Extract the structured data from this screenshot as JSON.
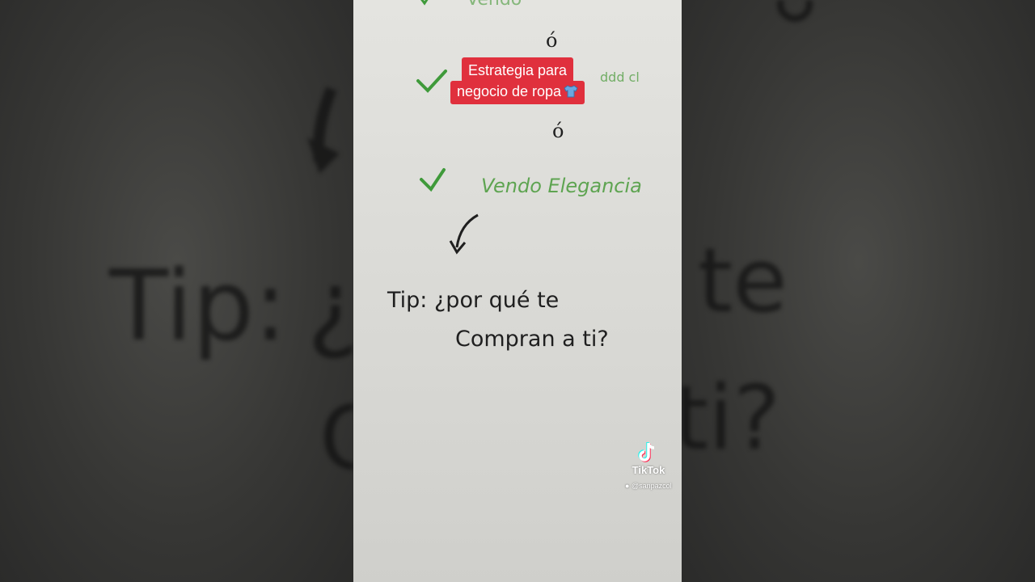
{
  "caption": {
    "line1": "Estrategia para",
    "line2": "negocio de ropa"
  },
  "watermark": {
    "brand": "TikTok",
    "handle": "@sanpazcol"
  },
  "board": {
    "or_1": "ó",
    "or_2": "ó",
    "item_3": "Vendo Elegancia",
    "tip_line1": "Tip: ¿por qué te",
    "tip_line2": "Compran a ti?"
  },
  "colors": {
    "caption_bg": "#e0303d",
    "check_green": "#3f9a3a",
    "marker_black": "#1f1f1f"
  },
  "icons": [
    "shirt-emoji-icon",
    "check-icon",
    "arrow-icon",
    "tiktok-logo-icon",
    "user-icon"
  ]
}
